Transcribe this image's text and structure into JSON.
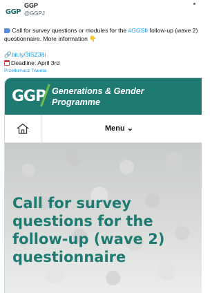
{
  "tweet": {
    "author_name": "GGP",
    "author_handle": "@GGPJ",
    "avatar_text": "GGP",
    "text_before_hashtag": " Call for survey questions or modules for the ",
    "hashtag": "#GGSII",
    "text_after_hashtag": " follow-up (wave 2) questionnaire. More information ",
    "link": "bit.ly/3ISZ38i",
    "deadline": "Deadline: April 3rd",
    "translate_label": "Przetłumacz Tweeta"
  },
  "card": {
    "logo_text": "GGP",
    "brand_line1": "Generations & Gender",
    "brand_line2": "Programme",
    "menu_label": "Menu",
    "menu_chevron": "⌄",
    "hero_title": "Call for survey questions for the follow-up (wave 2) questionnaire",
    "colors": {
      "header": "#1f7a72",
      "accent": "#6cc04a",
      "title": "#1f7a72"
    }
  },
  "icons": [
    "megaphone-icon",
    "pointing-down-icon",
    "link-icon",
    "calendar-icon",
    "home-icon",
    "chevron-down-icon"
  ]
}
